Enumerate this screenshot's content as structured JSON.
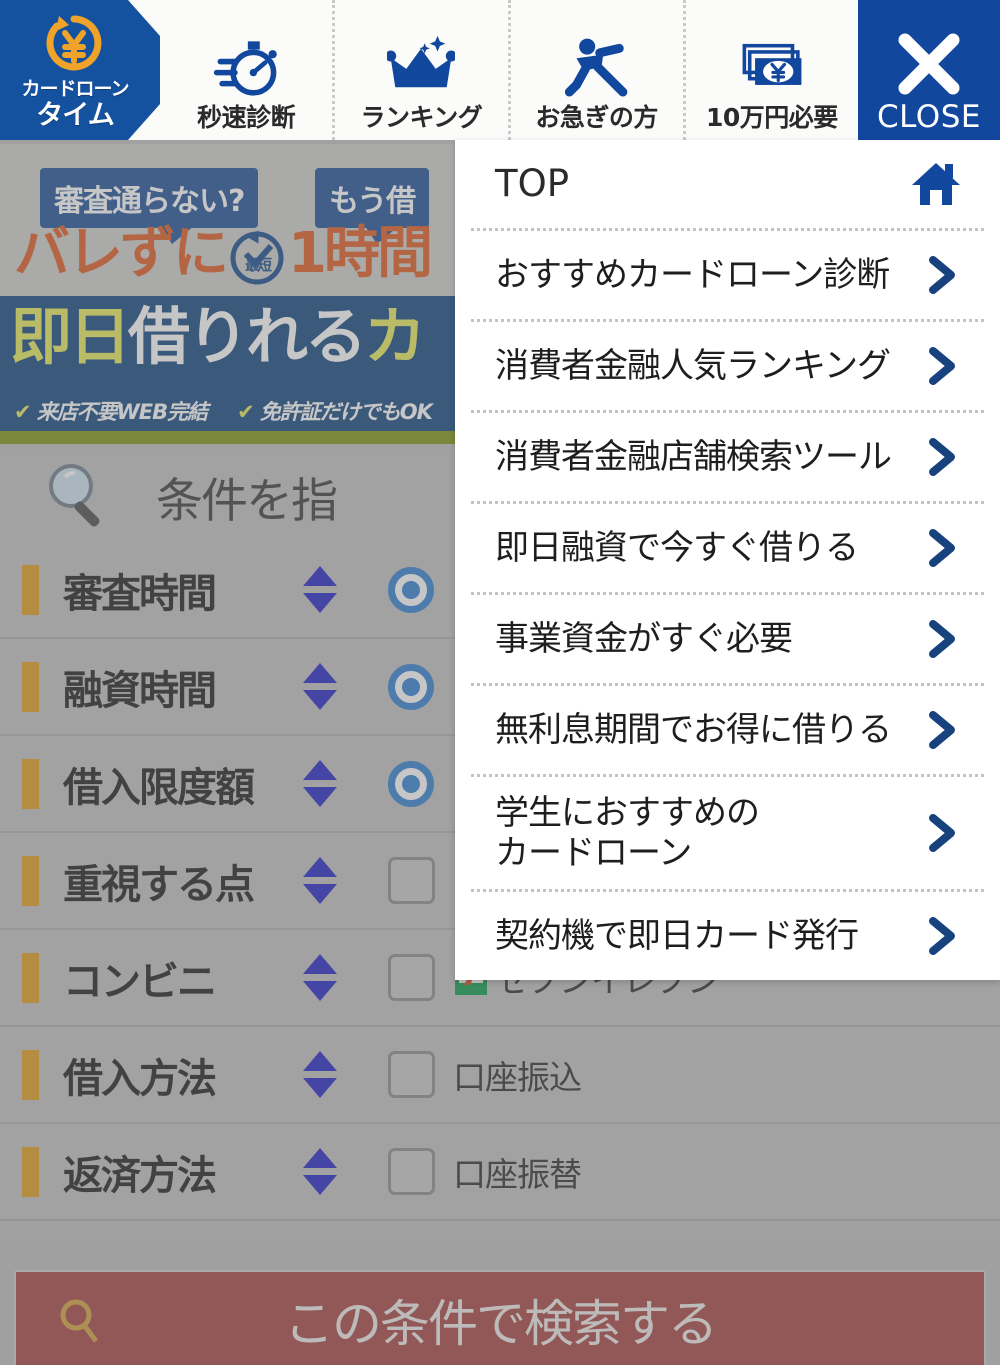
{
  "header": {
    "logo": {
      "line1": "カードローン",
      "line2": "タイム",
      "icon": "yen-coin-refresh-icon"
    },
    "nav": [
      {
        "label": "秒速診断",
        "icon": "stopwatch-icon"
      },
      {
        "label": "ランキング",
        "icon": "crown-icon"
      },
      {
        "label": "お急ぎの方",
        "icon": "running-person-icon"
      },
      {
        "label": "10万円必要",
        "icon": "banknotes-yen-icon"
      }
    ],
    "close": {
      "label": "CLOSE",
      "icon": "close-x-icon"
    }
  },
  "menu": {
    "items": [
      {
        "label": "TOP",
        "icon": "home-icon",
        "top": true
      },
      {
        "label": "おすすめカードローン診断",
        "icon": "chevron-right-icon"
      },
      {
        "label": "消費者金融人気ランキング",
        "icon": "chevron-right-icon"
      },
      {
        "label": "消費者金融店舗検索ツール",
        "icon": "chevron-right-icon"
      },
      {
        "label": "即日融資で今すぐ借りる",
        "icon": "chevron-right-icon"
      },
      {
        "label": "事業資金がすぐ必要",
        "icon": "chevron-right-icon"
      },
      {
        "label": "無利息期間でお得に借りる",
        "icon": "chevron-right-icon"
      },
      {
        "label": "学生におすすめの\nカードローン",
        "icon": "chevron-right-icon",
        "tall": true
      },
      {
        "label": "契約機で即日カード発行",
        "icon": "chevron-right-icon"
      }
    ]
  },
  "banner": {
    "bubble1": "審査通らない?",
    "bubble2": "もう借",
    "headline1_a": "バレずに",
    "headline1_badge": "最短",
    "headline1_b": "1時間",
    "headline2_a": "即日",
    "headline2_b": "借りれる",
    "headline2_c": "カ",
    "features": [
      "来店不要WEB完結",
      "免許証だけでもOK"
    ],
    "check": "✔"
  },
  "search": {
    "heading": "条件を指",
    "heading_icon": "magnifier-icon",
    "rows": [
      {
        "label": "審査時間",
        "type": "radio",
        "options": []
      },
      {
        "label": "融資時間",
        "type": "radio",
        "options": []
      },
      {
        "label": "借入限度額",
        "type": "radio",
        "options": []
      },
      {
        "label": "重視する点",
        "type": "checkbox",
        "options": []
      },
      {
        "label": "コンビニ",
        "type": "checkbox",
        "options": [
          {
            "label": "セブンイレブン",
            "icon": "seven-eleven-icon"
          }
        ]
      },
      {
        "label": "借入方法",
        "type": "checkbox",
        "options": [
          {
            "label": "口座振込"
          }
        ]
      },
      {
        "label": "返済方法",
        "type": "checkbox",
        "options": [
          {
            "label": "口座振替"
          }
        ]
      }
    ],
    "cta": {
      "label": "この条件で検索する",
      "icon": "magnifier-icon"
    }
  },
  "colors": {
    "brand_blue": "#12479e",
    "logo_blue": "#1452a0",
    "accent_orange": "#e09c1c",
    "banner_blue": "#10447f",
    "banner_green": "#7f9410",
    "cta_red": "#a64040",
    "radio_blue": "#2f7fd0",
    "arrow_blue": "#2121c8"
  }
}
